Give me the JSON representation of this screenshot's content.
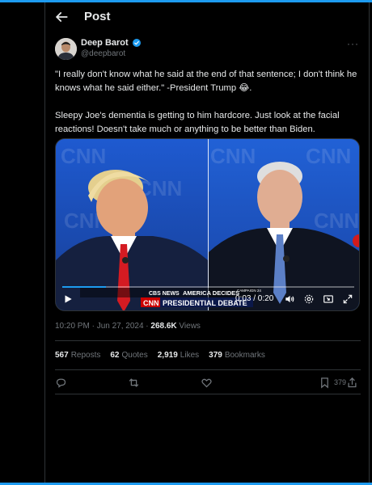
{
  "header": {
    "title": "Post"
  },
  "author": {
    "name": "Deep Barot",
    "handle": "@deepbarot"
  },
  "tweet": {
    "line1": "\"I really don't know what he said at the end of that sentence; I don't think he knows what he said either.\" -President Trump 😂.",
    "line2": "Sleepy Joe's dementia is getting to him hardcore. Just look at the facial reactions! Doesn't take much or anything to be better than Biden."
  },
  "video": {
    "time": "0:03 / 0:20",
    "progress": 0.15,
    "overlay_brand": "CNN",
    "overlay_news": "CBS NEWS",
    "overlay_headline": "AMERICA DECIDES",
    "overlay_sub": "PRESIDENTIAL DEBATE",
    "overlay_tag": "CAMPAIGN 24"
  },
  "meta": {
    "time": "10:20 PM · Jun 27, 2024 · ",
    "views_count": "268.6K",
    "views_label": " Views"
  },
  "stats": {
    "reposts_count": "567",
    "reposts_label": "Reposts",
    "quotes_count": "62",
    "quotes_label": "Quotes",
    "likes_count": "2,919",
    "likes_label": "Likes",
    "bookmarks_count": "379",
    "bookmarks_label": "Bookmarks"
  },
  "actions": {
    "bookmark_count": "379"
  },
  "colors": {
    "accent": "#1d9bf0",
    "background": "#000000",
    "muted": "#71767b",
    "text": "#e7e9ea"
  }
}
